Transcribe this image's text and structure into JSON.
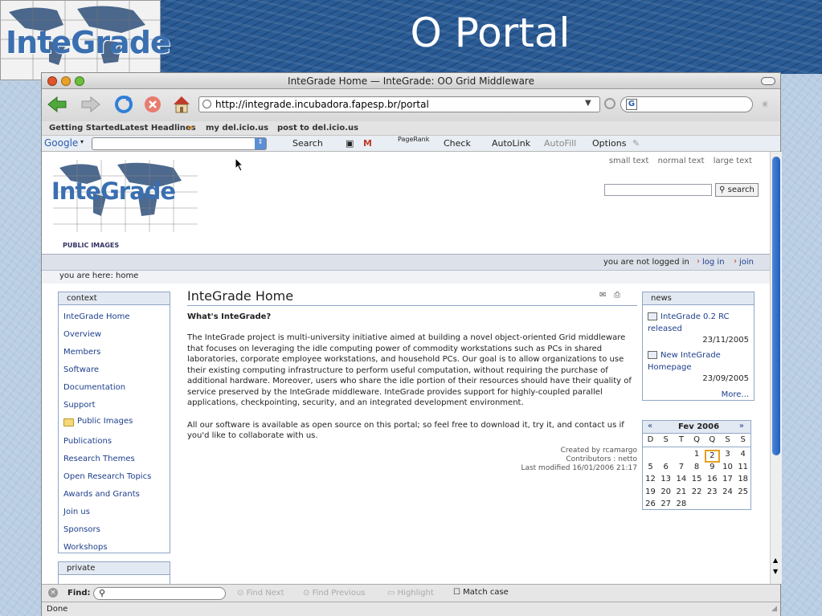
{
  "slide": {
    "title": "O Portal",
    "logo_text": "InteGrade"
  },
  "browser": {
    "window_title": "InteGrade Home — InteGrade: OO Grid Middleware",
    "url": "http://integrade.incubadora.fapesp.br/portal",
    "bookmarks": [
      "Getting Started",
      "Latest Headlines",
      "my del.icio.us",
      "post to del.icio.us"
    ],
    "google_toolbar": {
      "brand": "Google",
      "search": "Search",
      "pagerank": "PageRank",
      "check": "Check",
      "autolink": "AutoLink",
      "autofill": "AutoFill",
      "options": "Options"
    },
    "findbar": {
      "label": "Find:",
      "find_next": "Find Next",
      "find_previous": "Find Previous",
      "highlight": "Highlight",
      "match_case": "Match case"
    },
    "status": "Done"
  },
  "site": {
    "logo_text": "InteGrade",
    "text_sizes": [
      "small text",
      "normal text",
      "large text"
    ],
    "search_button": "search",
    "public_images_link": "PUBLIC IMAGES",
    "login_status": "you are not logged in",
    "login_link": "log in",
    "join_link": "join",
    "breadcrumb": "you are here: home"
  },
  "context_portlet": {
    "title": "context",
    "items": [
      "InteGrade Home",
      "Overview",
      "Members",
      "Software",
      "Documentation",
      "Support",
      "Public Images",
      "Publications",
      "Research Themes",
      "Open Research Topics",
      "Awards and Grants",
      "Join us",
      "Sponsors",
      "Workshops"
    ]
  },
  "private_portlet": {
    "title": "private"
  },
  "content": {
    "title": "InteGrade Home",
    "subtitle": "What's InteGrade?",
    "paragraph1": "The InteGrade project is multi-university initiative aimed at building a novel object-oriented  Grid middleware that focuses on leveraging the idle computing power of commodity workstations such as PCs in shared laboratories, corporate employee workstations, and household PCs. Our goal is to allow organizations to use their existing computing infrastructure to perform useful computation, without requiring the purchase of additional hardware. Moreover, users who share the idle portion of their resources should have their quality of service preserved by the InteGrade middleware. InteGrade provides support for highly-coupled parallel applications, checkpointing, security, and an integrated development environment.",
    "paragraph2": "All our software is available as open source on this portal; so feel free to download it, try it, and contact us if you'd like to collaborate with us.",
    "created_by": "Created by rcamargo",
    "contributors": "Contributors : netto",
    "last_modified": "Last modified 16/01/2006 21:17"
  },
  "news": {
    "title": "news",
    "items": [
      {
        "title": "InteGrade 0.2 RC released",
        "date": "23/11/2005"
      },
      {
        "title": "New InteGrade Homepage",
        "date": "23/09/2005"
      }
    ],
    "more": "More..."
  },
  "calendar": {
    "prev": "«",
    "next": "»",
    "month": "Fev 2006",
    "weekdays": [
      "D",
      "S",
      "T",
      "Q",
      "Q",
      "S",
      "S"
    ],
    "weeks": [
      [
        "",
        "",
        "",
        "1",
        "2",
        "3",
        "4"
      ],
      [
        "5",
        "6",
        "7",
        "8",
        "9",
        "10",
        "11"
      ],
      [
        "12",
        "13",
        "14",
        "15",
        "16",
        "17",
        "18"
      ],
      [
        "19",
        "20",
        "21",
        "22",
        "23",
        "24",
        "25"
      ],
      [
        "26",
        "27",
        "28",
        "",
        "",
        "",
        ""
      ]
    ],
    "today": "2"
  }
}
